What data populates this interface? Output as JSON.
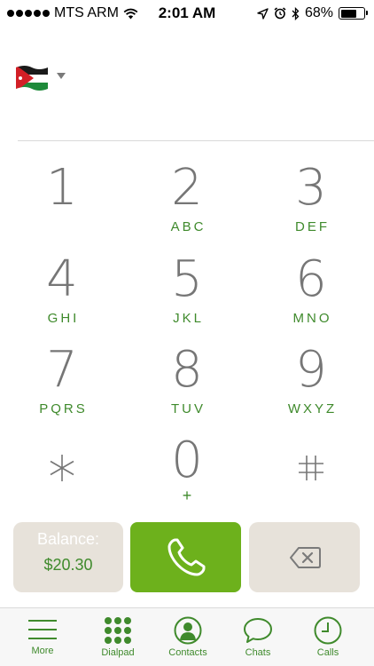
{
  "status_bar": {
    "carrier": "MTS ARM",
    "time": "2:01 AM",
    "battery": "68%",
    "battery_level": 0.68
  },
  "country_selector": {
    "flag_icon": "jordan-flag-icon"
  },
  "dialpad": {
    "keys": [
      {
        "digit": "1",
        "letters": ""
      },
      {
        "digit": "2",
        "letters": "ABC"
      },
      {
        "digit": "3",
        "letters": "DEF"
      },
      {
        "digit": "4",
        "letters": "GHI"
      },
      {
        "digit": "5",
        "letters": "JKL"
      },
      {
        "digit": "6",
        "letters": "MNO"
      },
      {
        "digit": "7",
        "letters": "PQRS"
      },
      {
        "digit": "8",
        "letters": "TUV"
      },
      {
        "digit": "9",
        "letters": "WXYZ"
      },
      {
        "digit": "*",
        "letters": ""
      },
      {
        "digit": "0",
        "letters": "+"
      },
      {
        "digit": "#",
        "letters": ""
      }
    ]
  },
  "actions": {
    "balance_label": "Balance:",
    "balance_value": "$20.30",
    "call_icon": "phone-icon",
    "backspace_icon": "backspace-icon"
  },
  "tabs": [
    {
      "label": "More",
      "icon": "menu-icon"
    },
    {
      "label": "Dialpad",
      "icon": "dialpad-grid-icon"
    },
    {
      "label": "Contacts",
      "icon": "contact-person-icon"
    },
    {
      "label": "Chats",
      "icon": "chat-bubble-icon"
    },
    {
      "label": "Calls",
      "icon": "clock-icon"
    }
  ],
  "colors": {
    "accent_green": "#3f8a2c",
    "call_green": "#6db11c",
    "button_beige": "#e7e2da",
    "digit_gray": "#767676"
  }
}
